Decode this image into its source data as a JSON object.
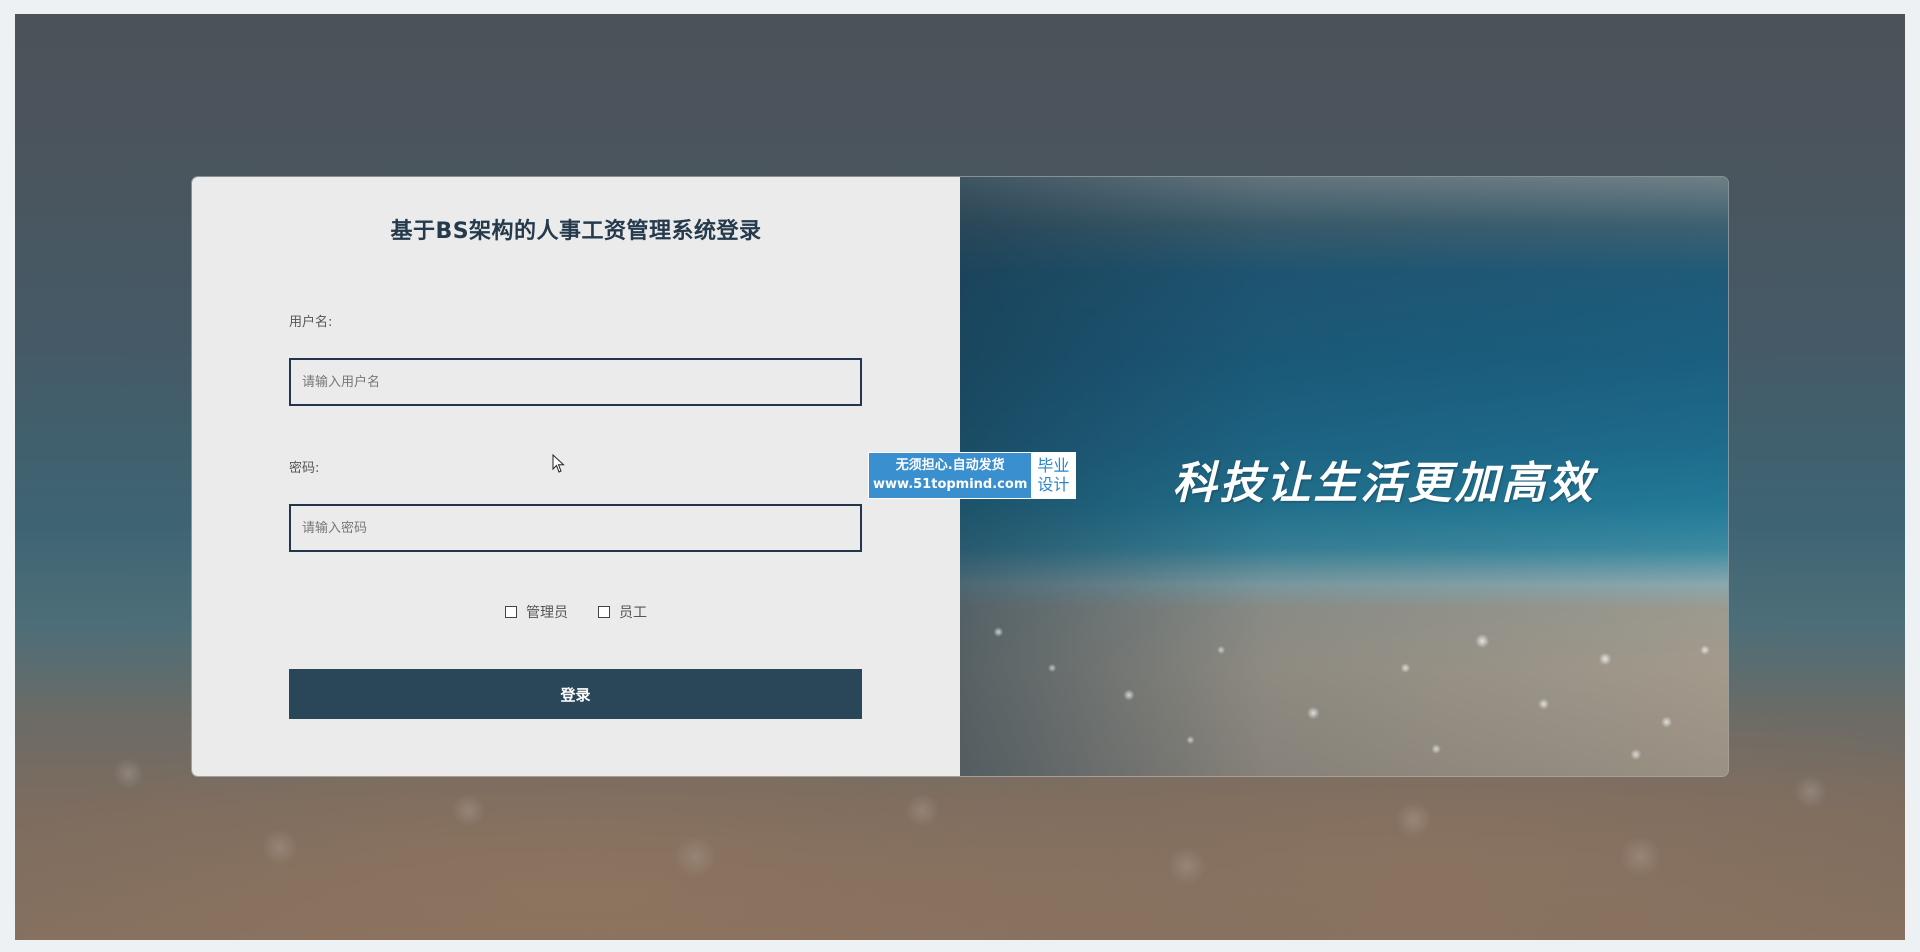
{
  "login": {
    "title": "基于BS架构的人事工资管理系统登录",
    "username_label": "用户名:",
    "username_placeholder": "请输入用户名",
    "password_label": "密码:",
    "password_placeholder": "请输入密码",
    "roles": [
      "管理员",
      "员工"
    ],
    "submit_label": "登录"
  },
  "banner": {
    "slogan": "科技让生活更加高效"
  },
  "watermark": {
    "line1": "无须担心.自动发货",
    "line2": "www.51topmind.com",
    "tag_line1": "毕业",
    "tag_line2": "设计"
  },
  "colors": {
    "primary": "#2a4759",
    "title": "#253a4c",
    "input_border": "#23354f",
    "panel_bg": "#ebebeb"
  }
}
